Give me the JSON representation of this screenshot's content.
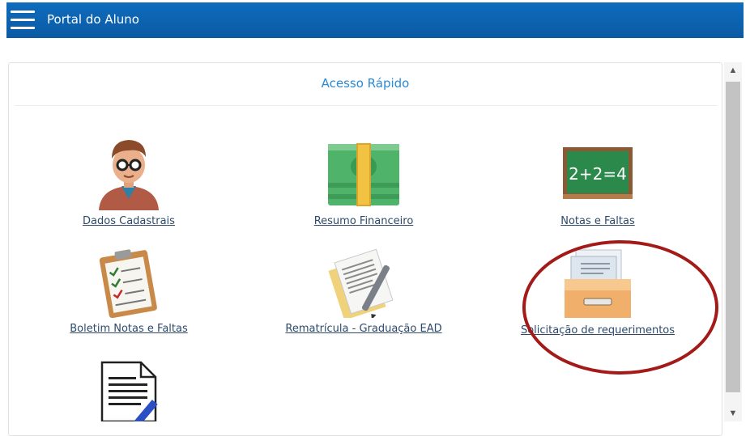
{
  "header": {
    "title": "Portal do Aluno"
  },
  "panel": {
    "heading": "Acesso Rápido"
  },
  "tiles": [
    {
      "label": "Dados Cadastrais",
      "icon": "student-avatar-icon"
    },
    {
      "label": "Resumo Financeiro",
      "icon": "money-stack-icon"
    },
    {
      "label": "Notas e Faltas",
      "icon": "chalkboard-icon"
    },
    {
      "label": "Boletim Notas e Faltas",
      "icon": "clipboard-checklist-icon"
    },
    {
      "label": "Rematrícula - Graduação EAD",
      "icon": "document-pen-icon"
    },
    {
      "label": "Solicitação de requerimentos",
      "icon": "file-drawer-icon"
    },
    {
      "label": "",
      "icon": "document-edit-icon"
    }
  ],
  "chalkboard_text": "2+2=4",
  "colors": {
    "header": "#0f6cbd",
    "heading": "#2a8ad6",
    "annotation": "#a31a18"
  }
}
